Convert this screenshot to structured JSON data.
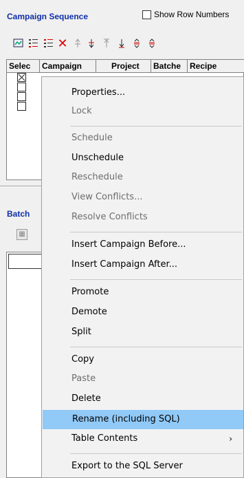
{
  "header": {
    "title": "Campaign Sequence",
    "show_row_numbers_label": "Show Row Numbers"
  },
  "grid": {
    "columns": [
      "Selec",
      "Campaign",
      "Project",
      "Batche",
      "Recipe"
    ]
  },
  "batch": {
    "title": "Batch"
  },
  "menu": {
    "items": [
      {
        "label": "Properties...",
        "enabled": true
      },
      {
        "label": "Lock",
        "enabled": false
      },
      {
        "label": "Schedule",
        "enabled": false
      },
      {
        "label": "Unschedule",
        "enabled": true
      },
      {
        "label": "Reschedule",
        "enabled": false
      },
      {
        "label": "View Conflicts...",
        "enabled": false
      },
      {
        "label": "Resolve Conflicts",
        "enabled": false
      },
      {
        "label": "Insert Campaign Before...",
        "enabled": true
      },
      {
        "label": "Insert Campaign After...",
        "enabled": true
      },
      {
        "label": "Promote",
        "enabled": true
      },
      {
        "label": "Demote",
        "enabled": true
      },
      {
        "label": "Split",
        "enabled": true
      },
      {
        "label": "Copy",
        "enabled": true
      },
      {
        "label": "Paste",
        "enabled": false
      },
      {
        "label": "Delete",
        "enabled": true
      },
      {
        "label": "Rename (including SQL)",
        "enabled": true,
        "highlighted": true
      },
      {
        "label": "Table Contents",
        "enabled": true,
        "submenu": true,
        "submenu_glyph": "›"
      },
      {
        "label": "Export to the SQL Server",
        "enabled": true
      }
    ]
  },
  "colors": {
    "title_blue": "#0f2fa8",
    "menu_highlight": "#91c9f7",
    "disabled_text": "#6d6d6d"
  },
  "icons": {
    "toolbar": [
      "properties-icon",
      "list-add-icon",
      "list-insert-icon",
      "delete-x-icon",
      "move-up-icon",
      "move-down-icon",
      "move-top-icon",
      "move-bottom-icon",
      "split-up-icon",
      "split-down-icon"
    ]
  }
}
